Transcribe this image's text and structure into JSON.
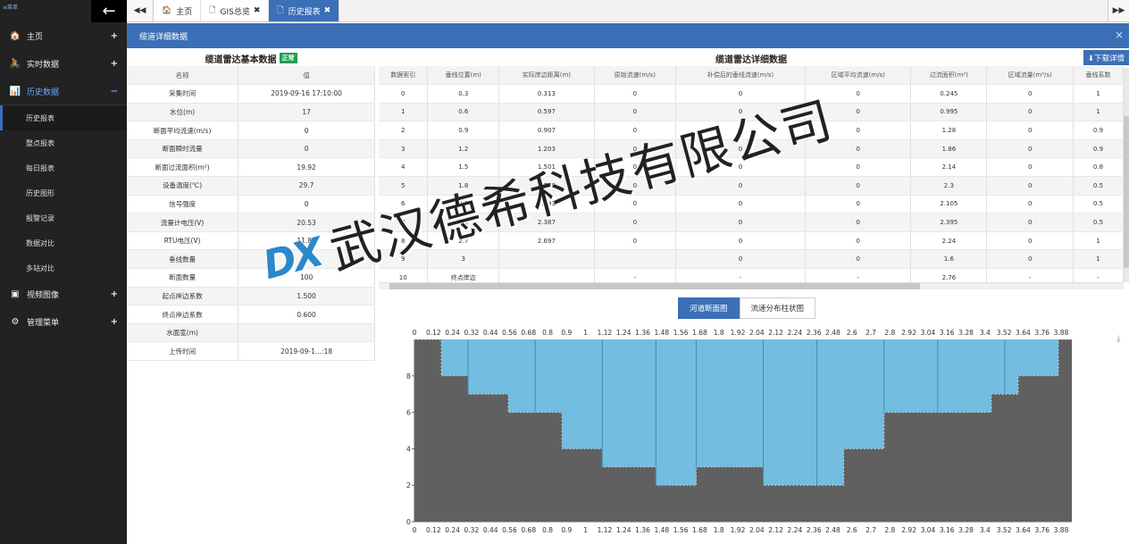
{
  "sidebar": {
    "brand": "≡菜单",
    "back_icon": "←",
    "menus": [
      {
        "icon": "🏠",
        "label": "主页",
        "toggle": "+"
      },
      {
        "icon": "🚴",
        "label": "实时数据",
        "toggle": "+"
      },
      {
        "icon": "📊",
        "label": "历史数据",
        "toggle": "−"
      },
      {
        "icon": "▣",
        "label": "视频图像",
        "toggle": "+"
      },
      {
        "icon": "⚙",
        "label": "管理菜单",
        "toggle": "+"
      }
    ],
    "history_submenu": [
      "历史报表",
      "整点报表",
      "每日报表",
      "历史图形",
      "报警记录",
      "数据对比",
      "多站对比"
    ]
  },
  "tabs": [
    {
      "icon": "🏠",
      "label": "主页",
      "close": ""
    },
    {
      "icon": "🗋",
      "label": "GIS总览",
      "close": "✖"
    },
    {
      "icon": "🗋",
      "label": "历史报表",
      "close": "✖"
    }
  ],
  "nav": {
    "prev": "◀◀",
    "next": "▶▶"
  },
  "panel": {
    "title": "缆道详细数据",
    "close": "×"
  },
  "basic": {
    "title": "缆道雷达基本数据",
    "status": "正常",
    "headers": [
      "名称",
      "值"
    ],
    "rows": [
      [
        "采集时间",
        "2019-09-16 17:10:00"
      ],
      [
        "水位(m)",
        "17"
      ],
      [
        "断面平均流速(m/s)",
        "0"
      ],
      [
        "断面瞬时流量",
        "0"
      ],
      [
        "断面过流面积(m²)",
        "19.92"
      ],
      [
        "设备温度(℃)",
        "29.7"
      ],
      [
        "信号强度",
        "0"
      ],
      [
        "流量计电压(V)",
        "20.53"
      ],
      [
        "RTU电压(V)",
        "11.84"
      ],
      [
        "垂线数量",
        "10"
      ],
      [
        "断面数量",
        "100"
      ],
      [
        "起点岸边系数",
        "1.500"
      ],
      [
        "终点岸边系数",
        "0.600"
      ],
      [
        "水面宽(m)",
        ""
      ],
      [
        "上传时间",
        "2019-09-1...:18"
      ]
    ]
  },
  "detail": {
    "title": "缆道雷达详细数据",
    "download": "⬇下载详情",
    "headers": [
      "数据索引",
      "垂线位置(m)",
      "实际岸边距离(m)",
      "原始流速(m/s)",
      "补偿后的垂线流速(m/s)",
      "区域平均流速(m/s)",
      "过流面积(m²)",
      "区域流量(m³/s)",
      "垂线系数"
    ],
    "rows": [
      [
        "0",
        "0.3",
        "0.313",
        "0",
        "0",
        "0",
        "0.245",
        "0",
        "1"
      ],
      [
        "1",
        "0.6",
        "0.597",
        "0",
        "0",
        "0",
        "0.995",
        "0",
        "1"
      ],
      [
        "2",
        "0.9",
        "0.907",
        "0",
        "0",
        "0",
        "1.28",
        "0",
        "0.9"
      ],
      [
        "3",
        "1.2",
        "1.203",
        "0",
        "0",
        "0",
        "1.86",
        "0",
        "0.9"
      ],
      [
        "4",
        "1.5",
        "1.501",
        "0",
        "0",
        "0",
        "2.14",
        "0",
        "0.8"
      ],
      [
        "5",
        "1.8",
        "1.798",
        "0",
        "0",
        "0",
        "2.3",
        "0",
        "0.5"
      ],
      [
        "6",
        "2.1",
        "2.093",
        "0",
        "0",
        "0",
        "2.105",
        "0",
        "0.5"
      ],
      [
        "7",
        "2.4",
        "2.387",
        "0",
        "0",
        "0",
        "2.395",
        "0",
        "0.5"
      ],
      [
        "8",
        "2.7",
        "2.697",
        "0",
        "0",
        "0",
        "2.24",
        "0",
        "1"
      ],
      [
        "9",
        "3",
        "",
        "",
        "0",
        "0",
        "1.6",
        "0",
        "1"
      ],
      [
        "10",
        "终点岸边",
        "",
        "-",
        "-",
        "-",
        "2.76",
        "-",
        "-"
      ]
    ]
  },
  "chart_tabs": [
    "河道断面图",
    "流速分布柱状图"
  ],
  "chart_download_icon": "⤓",
  "chart_data": {
    "type": "area",
    "x_ticks": [
      "0",
      "0.12",
      "0.24",
      "0.32",
      "0.44",
      "0.56",
      "0.68",
      "0.8",
      "0.9",
      "1",
      "1.12",
      "1.24",
      "1.36",
      "1.48",
      "1.56",
      "1.68",
      "1.8",
      "1.92",
      "2.04",
      "2.12",
      "2.24",
      "2.36",
      "2.48",
      "2.6",
      "2.7",
      "2.8",
      "2.92",
      "3.04",
      "3.16",
      "3.28",
      "3.4",
      "3.52",
      "3.64",
      "3.76",
      "3.88"
    ],
    "ylim": [
      0,
      10
    ],
    "y_ticks": [
      "0",
      "2",
      "4",
      "6",
      "8"
    ],
    "top_labels": [
      "0",
      "0.12",
      "0.24",
      "0.32",
      "0.44",
      "0.56",
      "0.68",
      "0.8",
      "0.9",
      "1",
      "1.12",
      "1.24",
      "1.36",
      "1.48",
      "1.56",
      "1.68",
      "1.8",
      "1.92",
      "2.04",
      "2.12",
      "2.24",
      "2.36",
      "2.48",
      "2.6",
      "2.7",
      "2.8",
      "2.92",
      "3.04",
      "3.16",
      "3.28",
      "3.4",
      "3.52",
      "3.64",
      "3.76",
      "3.88"
    ],
    "bed_profile": [
      10,
      10,
      8,
      8,
      7,
      7,
      7,
      6,
      6,
      6,
      6,
      4,
      4,
      4,
      3,
      3,
      3,
      3,
      2,
      2,
      2,
      3,
      3,
      3,
      3,
      3,
      2,
      2,
      2,
      2,
      2,
      2,
      4,
      4,
      4,
      6,
      6,
      6,
      6,
      6,
      6,
      6,
      6,
      7,
      7,
      8,
      8,
      8,
      10,
      10
    ],
    "water_level": 10,
    "colors": {
      "water": "#72bde0",
      "bed": "#606060",
      "vertical_line": "#3d8fb5"
    }
  },
  "watermark": {
    "logo": "DX",
    "text": "武汉德希科技有限公司"
  }
}
